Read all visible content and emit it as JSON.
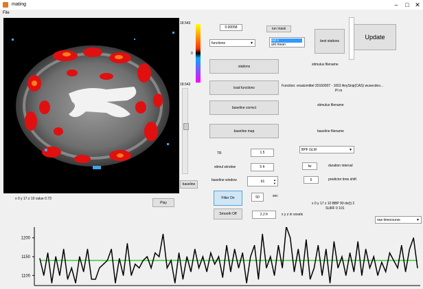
{
  "window": {
    "title": "mating",
    "menu_file": "File"
  },
  "colorbar": {
    "max_label": "18.543",
    "mid_label": "0",
    "min_label": "18.543"
  },
  "top": {
    "value_field": "0.00058",
    "function_select": "functions",
    "small_button": "run mask",
    "list_items": [
      "out s",
      "ant mean"
    ],
    "right_button": "best stations",
    "update_button": "Update"
  },
  "buttons": {
    "b1": "stations",
    "b2": "load functions",
    "b3": "baseline correct",
    "b4": "baseline map",
    "slider_button": "baseline"
  },
  "info": {
    "function_text": "Function: ersatzmittel 20160007 - 1002 AnySnip(CAS) wuxecdeo...",
    "function_sub": "PI m",
    "stimulus_label": "stimulus filename",
    "baseline_label": "baseline filename",
    "header_label": "stimulus filename"
  },
  "form": {
    "tr_label": "TR",
    "tr_value": "1.5",
    "stim_label": "stimul window",
    "stim_value": "5 fr",
    "baseline_label": "baseline window",
    "baseline_value": "b1",
    "filter_select": "BPF GLM",
    "duration_value": "fw",
    "duration_label": "duration interval",
    "predict_value": "5",
    "predict_label": "predictor time shift",
    "filter_button": "Filter On",
    "filter_value": "50",
    "filter_unit": "sec",
    "smooth_button": "Smooth Off",
    "smooth_value": "2.2 fr",
    "smooth_label": "x y z in voxels"
  },
  "status": {
    "coord_left": "x 0  y 17  z 10  value  0.73",
    "play_button": "Play",
    "coord_right": "x 0  y 17  z 10  BBP 90 dv(t) 2",
    "coord_right2": "SURF 0 101",
    "plot_select": "raw timecourse"
  },
  "colors": {
    "line": "#000000",
    "mean_line": "#33cc33"
  },
  "chart_data": {
    "type": "line",
    "title": "",
    "xlabel": "",
    "ylabel": "",
    "yticks": [
      "1200",
      "1150",
      "1100"
    ],
    "ylim": [
      1075,
      1225
    ],
    "mean": 1140,
    "series": [
      {
        "values": [
          1145,
          1100,
          1160,
          1080,
          1150,
          1100,
          1170,
          1090,
          1120,
          1080,
          1150,
          1110,
          1170,
          1090,
          1090,
          1120,
          1130,
          1140,
          1170,
          1080,
          1145,
          1100,
          1185,
          1100,
          1130,
          1120,
          1140,
          1150,
          1120,
          1160,
          1150,
          1210,
          1120,
          1140,
          1080,
          1160,
          1090,
          1150,
          1110,
          1170,
          1120,
          1150,
          1110,
          1160,
          1130,
          1150,
          1095,
          1180,
          1110,
          1170,
          1120,
          1160,
          1080,
          1150,
          1180,
          1090,
          1210,
          1120,
          1150,
          1100,
          1180,
          1120,
          1230,
          1200,
          1110,
          1170,
          1100,
          1195,
          1090,
          1120,
          1180,
          1100,
          1170,
          1080,
          1190,
          1120,
          1150,
          1100,
          1160,
          1110,
          1190,
          1100,
          1170,
          1120,
          1150,
          1100,
          1135,
          1110,
          1160,
          1140,
          1120,
          1180,
          1110,
          1170,
          1200,
          1120
        ]
      }
    ]
  }
}
